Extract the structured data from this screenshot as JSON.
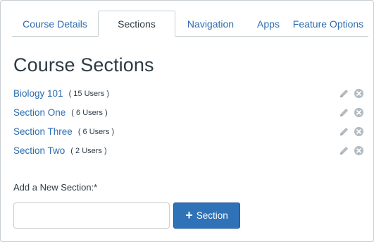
{
  "tabs": [
    {
      "label": "Course Details",
      "active": false
    },
    {
      "label": "Sections",
      "active": true
    },
    {
      "label": "Navigation",
      "active": false
    },
    {
      "label": "Apps",
      "active": false
    },
    {
      "label": "Feature Options",
      "active": false
    }
  ],
  "page": {
    "title": "Course Sections"
  },
  "sections": [
    {
      "name": "Biology 101",
      "count": "( 15 Users )"
    },
    {
      "name": "Section One",
      "count": "( 6 Users )"
    },
    {
      "name": "Section Three",
      "count": "( 6 Users )"
    },
    {
      "name": "Section Two",
      "count": "( 2 Users )"
    }
  ],
  "icons": {
    "edit": "pencil-icon",
    "delete": "remove-circle-icon",
    "add": "plus-icon"
  },
  "add_section": {
    "label": "Add a New Section:*",
    "input_value": "",
    "input_placeholder": "",
    "button_label": "Section",
    "button_icon": "+"
  },
  "colors": {
    "link": "#2d6cb0",
    "text": "#2d3b45",
    "button": "#2f72b8",
    "icon": "#b4bcc2"
  }
}
